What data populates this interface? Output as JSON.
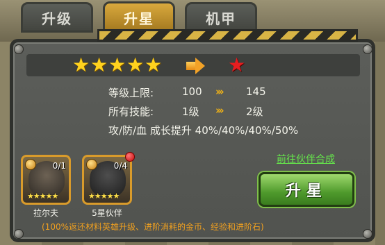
{
  "tabs": [
    {
      "label": "升级",
      "active": false
    },
    {
      "label": "升星",
      "active": true
    },
    {
      "label": "机甲",
      "active": false
    }
  ],
  "star_progress": {
    "current_stars": 5,
    "next_stars": 1,
    "arrow_icon": "right-arrow-icon"
  },
  "stats": {
    "level_cap_label": "等级上限:",
    "level_cap_from": "100",
    "level_cap_to": "145",
    "skills_label": "所有技能:",
    "skills_from": "1级",
    "skills_to": "2级",
    "growth_text": "攻/防/血 成长提升 40%/40%/40%/50%"
  },
  "materials": [
    {
      "name": "拉尔夫",
      "count": "0/1"
    },
    {
      "name": "5星伙伴",
      "count": "0/4"
    }
  ],
  "link_text": "前往伙伴合成",
  "action_button": "升星",
  "footnote": "(100%返还材料英雄升级、进阶消耗的金币、经验和进阶石)",
  "colors": {
    "accent": "#d9a93d",
    "button": "#4f9a2c",
    "link": "#65e64b",
    "note": "#f0a020"
  }
}
